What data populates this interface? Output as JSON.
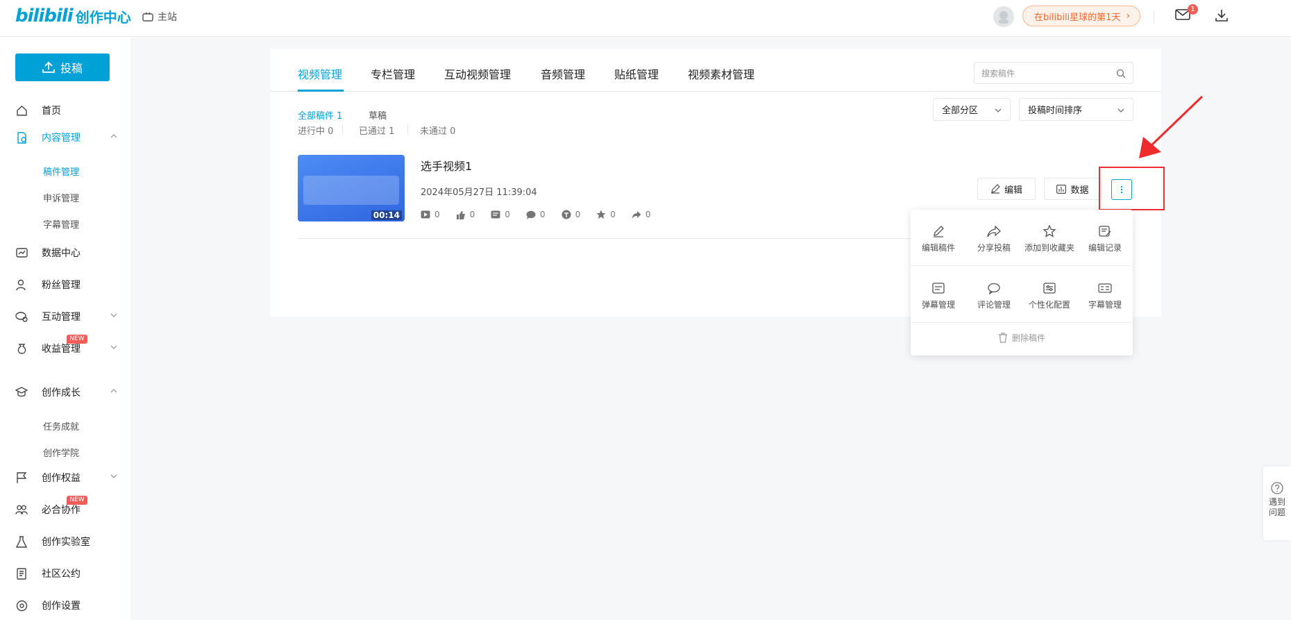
{
  "header": {
    "logo_brand": "bilibili",
    "logo_suffix": "创作中心",
    "home_link": "主站",
    "days_badge": "在bilibili星球的第1天",
    "mail_count": "1"
  },
  "sidebar": {
    "upload_label": "投稿",
    "items": [
      {
        "label": "首页",
        "icon": "home-icon"
      },
      {
        "label": "内容管理",
        "icon": "content-icon"
      },
      {
        "label": "数据中心",
        "icon": "chart-icon"
      },
      {
        "label": "粉丝管理",
        "icon": "user-icon"
      },
      {
        "label": "互动管理",
        "icon": "chat-icon"
      },
      {
        "label": "收益管理",
        "icon": "money-bag-icon"
      },
      {
        "label": "创作成长",
        "icon": "graduation-cap-icon"
      },
      {
        "label": "创作权益",
        "icon": "flag-icon"
      },
      {
        "label": "必合协作",
        "icon": "team-icon"
      },
      {
        "label": "创作实验室",
        "icon": "flask-icon"
      },
      {
        "label": "社区公约",
        "icon": "document-icon"
      },
      {
        "label": "创作设置",
        "icon": "settings-icon"
      }
    ],
    "content_sub": [
      "稿件管理",
      "申诉管理",
      "字幕管理"
    ],
    "growth_sub": [
      "任务成就",
      "创作学院"
    ],
    "new_tag": "NEW"
  },
  "main": {
    "tabs": [
      "视频管理",
      "专栏管理",
      "互动视频管理",
      "音频管理",
      "贴纸管理",
      "视频素材管理"
    ],
    "search_placeholder": "搜索稿件",
    "filter_all": "全部稿件 1",
    "filter_draft": "草稿",
    "status_in_progress": "进行中 0",
    "status_passed": "已通过 1",
    "status_rejected": "未通过 0",
    "select_zone": "全部分区",
    "select_sort": "投稿时间排序"
  },
  "video": {
    "title": "选手视频1",
    "date": "2024年05月27日 11:39:04",
    "duration": "00:14",
    "stats": {
      "plays": "0",
      "likes": "0",
      "danmaku": "0",
      "comments": "0",
      "coins": "0",
      "favorites": "0",
      "shares": "0"
    },
    "edit_label": "编辑",
    "data_label": "数据"
  },
  "dropdown": {
    "row1": [
      {
        "label": "编辑稿件",
        "icon": "pencil-icon"
      },
      {
        "label": "分享投稿",
        "icon": "share-icon"
      },
      {
        "label": "添加到收藏夹",
        "icon": "star-icon"
      },
      {
        "label": "编辑记录",
        "icon": "edit-record-icon"
      }
    ],
    "row2": [
      {
        "label": "弹幕管理",
        "icon": "danmaku-icon"
      },
      {
        "label": "评论管理",
        "icon": "comment-icon"
      },
      {
        "label": "个性化配置",
        "icon": "config-icon"
      },
      {
        "label": "字幕管理",
        "icon": "subtitle-icon"
      }
    ],
    "delete_label": "删除稿件"
  },
  "help": {
    "label": "遇到问题"
  }
}
